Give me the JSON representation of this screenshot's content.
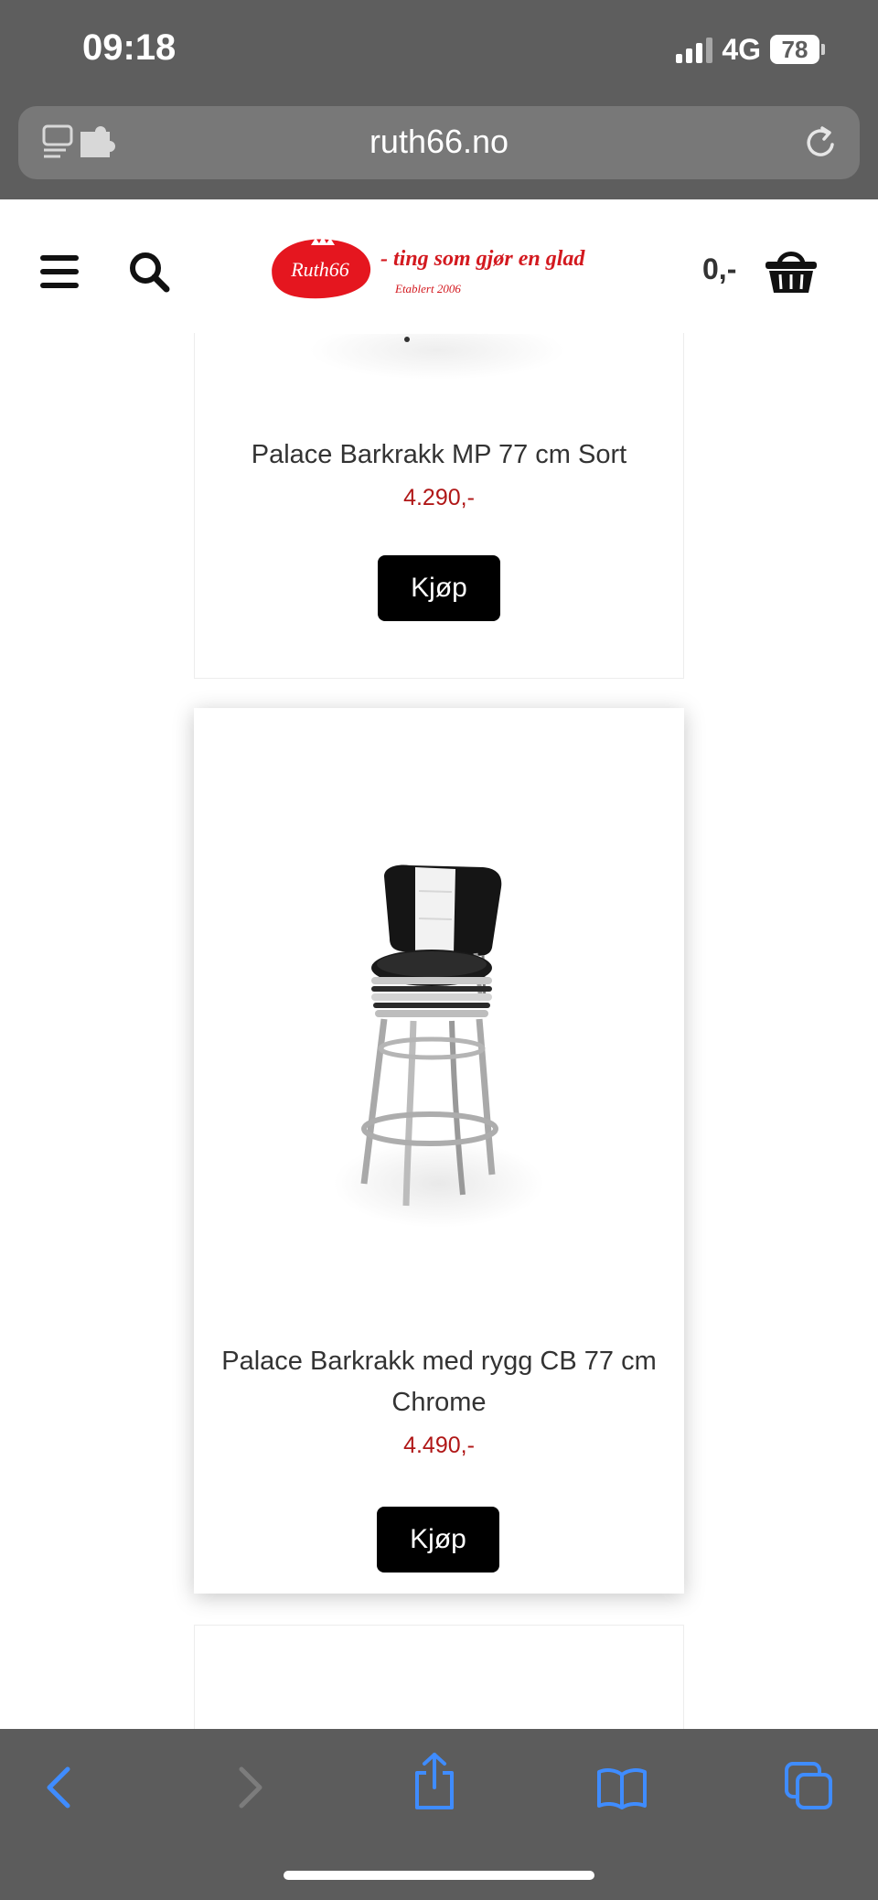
{
  "status_bar": {
    "time": "09:18",
    "network": "4G",
    "battery": "78"
  },
  "browser": {
    "url": "ruth66.no"
  },
  "header": {
    "logo": {
      "brand": "Ruth66",
      "tagline": "- ting som gjør en glad",
      "established": "Etablert 2006"
    },
    "cart_total": "0,-"
  },
  "products": [
    {
      "title": "Palace Barkrakk MP 77 cm Sort",
      "price": "4.290,-",
      "button": "Kjøp"
    },
    {
      "title": "Palace Barkrakk med rygg CB 77 cm Chrome",
      "price": "4.490,-",
      "button": "Kjøp"
    }
  ],
  "colors": {
    "price": "#b01717",
    "browser_chrome": "#5e5e5e",
    "accent": "#3f8cff",
    "logo_red": "#e5161f"
  },
  "icons": [
    "menu-icon",
    "search-icon",
    "cart-icon",
    "back-icon",
    "forward-icon",
    "share-icon",
    "bookmarks-icon",
    "tabs-icon",
    "reload-icon"
  ]
}
